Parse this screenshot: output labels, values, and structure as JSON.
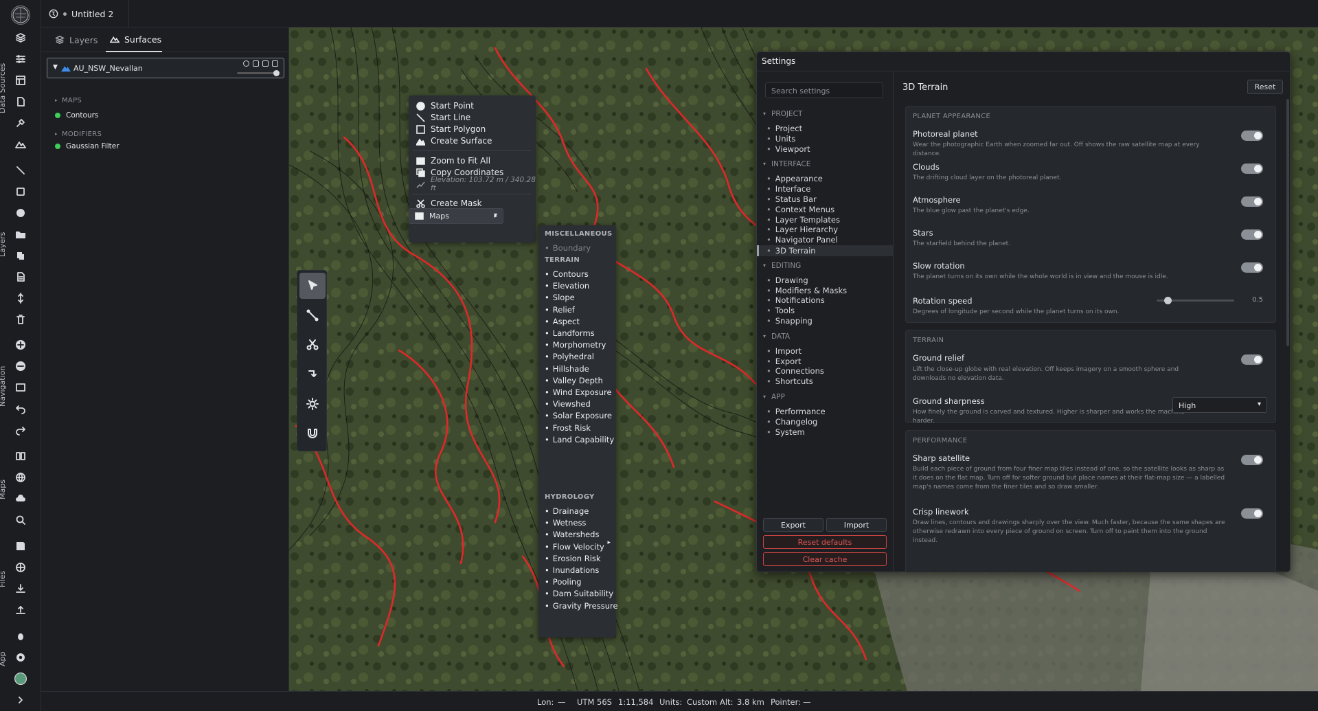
{
  "window": {
    "doc_title": "Untitled 2"
  },
  "rail": {
    "groups": [
      "Data Sources",
      "Layers",
      "Navigation",
      "Maps",
      "Files",
      "App"
    ]
  },
  "panel": {
    "tabs": [
      {
        "label": "Layers"
      },
      {
        "label": "Surfaces"
      }
    ],
    "active_tab": "Surfaces",
    "layer": {
      "name": "AU_NSW_Nevallan"
    },
    "sections": {
      "maps": "MAPS",
      "modifiers": "MODIFIERS"
    },
    "maps_items": [
      "Contours"
    ],
    "modifier_items": [
      "Gaussian Filter"
    ]
  },
  "context_menu": {
    "items": [
      "Start Point",
      "Start Line",
      "Start Polygon",
      "Create Surface",
      "Zoom to Fit All",
      "Copy Coordinates"
    ],
    "elevation": "Elevation: 103.72 m / 340.28 ft",
    "create_mask": "Create Mask",
    "maps": "Maps",
    "maps_arrow": "▸"
  },
  "maps_submenu": {
    "misc_header": "MISCELLANEOUS",
    "misc_items": [
      "Boundary"
    ],
    "terrain_header": "TERRAIN",
    "terrain_items": [
      "Contours",
      "Elevation",
      "Slope",
      "Relief",
      "Aspect",
      "Landforms",
      "Morphometry",
      "Polyhedral",
      "Hillshade",
      "Valley Depth",
      "Wind Exposure",
      "Viewshed",
      "Solar Exposure",
      "Frost Risk",
      "Land Capability"
    ],
    "hydrology_header": "HYDROLOGY",
    "hydrology_items": [
      "Drainage",
      "Wetness",
      "Watersheds",
      "Flow Velocity",
      "Erosion Risk",
      "Inundations",
      "Pooling",
      "Dam Suitability",
      "Gravity Pressure"
    ],
    "watersheds_arrow": "▸"
  },
  "settings": {
    "title": "Settings",
    "search_placeholder": "Search settings",
    "sections": [
      {
        "label": "PROJECT",
        "items": [
          "Project",
          "Units",
          "Viewport"
        ]
      },
      {
        "label": "INTERFACE",
        "items": [
          "Appearance",
          "Interface",
          "Status Bar",
          "Context Menus",
          "Layer Templates",
          "Layer Hierarchy",
          "Navigator Panel",
          "3D Terrain"
        ]
      },
      {
        "label": "EDITING",
        "items": [
          "Drawing",
          "Modifiers & Masks",
          "Notifications",
          "Tools",
          "Snapping"
        ]
      },
      {
        "label": "DATA",
        "items": [
          "Import",
          "Export",
          "Connections",
          "Shortcuts"
        ]
      },
      {
        "label": "APP",
        "items": [
          "Performance",
          "Changelog",
          "System"
        ]
      }
    ],
    "active_item": "3D Terrain",
    "buttons": {
      "export": "Export",
      "import": "Import",
      "reset_defaults": "Reset defaults",
      "clear_cache": "Clear cache"
    },
    "page_title": "3D Terrain",
    "reset_label": "Reset",
    "planet": {
      "header": "PLANET APPEARANCE",
      "rows": [
        {
          "title": "Photoreal planet",
          "desc": "Wear the photographic Earth when zoomed far out. Off shows the raw satellite map at every distance.",
          "on": true
        },
        {
          "title": "Clouds",
          "desc": "The drifting cloud layer on the photoreal planet.",
          "on": true
        },
        {
          "title": "Atmosphere",
          "desc": "The blue glow past the planet's edge.",
          "on": true
        },
        {
          "title": "Stars",
          "desc": "The starfield behind the planet.",
          "on": true
        },
        {
          "title": "Slow rotation",
          "desc": "The planet turns on its own while the whole world is in view and the mouse is idle.",
          "on": true
        }
      ],
      "rotation": {
        "title": "Rotation speed",
        "desc": "Degrees of longitude per second while the planet turns on its own.",
        "value": "0.5",
        "fraction": 0.14
      }
    },
    "terrain": {
      "header": "TERRAIN",
      "ground_relief": {
        "title": "Ground relief",
        "desc": "Lift the close-up globe with real elevation. Off keeps imagery on a smooth sphere and downloads no elevation data.",
        "on": true
      },
      "ground_sharpness": {
        "title": "Ground sharpness",
        "desc": "How finely the ground is carved and textured. Higher is sharper and works the machine harder.",
        "value": "High"
      }
    },
    "performance": {
      "header": "PERFORMANCE",
      "sharp": {
        "title": "Sharp satellite",
        "desc": "Build each piece of ground from four finer map tiles instead of one, so the satellite looks as sharp as it does on the flat map. Turn off for softer ground but place names at their flat-map size — a labelled map's names come from the finer tiles and so draw smaller.",
        "on": true
      },
      "crisp": {
        "title": "Crisp linework",
        "desc": "Draw lines, contours and drawings sharply over the view. Much faster, because the same shapes are otherwise redrawn into every piece of ground on screen. Turn off to paint them into the ground instead.",
        "on": true
      }
    }
  },
  "status": {
    "lon_label": "Lon:",
    "lon_value": "—",
    "utm": "UTM 56S",
    "scale": "1:11,584",
    "units_label": "Units:",
    "units_value": "Custom",
    "alt_label": "Alt:",
    "alt_value": "3.8 km",
    "pointer_label": "Pointer:",
    "pointer_value": "—"
  },
  "colors": {
    "contour_red": "#e0282a",
    "toggle_on": "#8b8f96",
    "danger": "#e05656",
    "active_dot": "#3ecf5a"
  }
}
